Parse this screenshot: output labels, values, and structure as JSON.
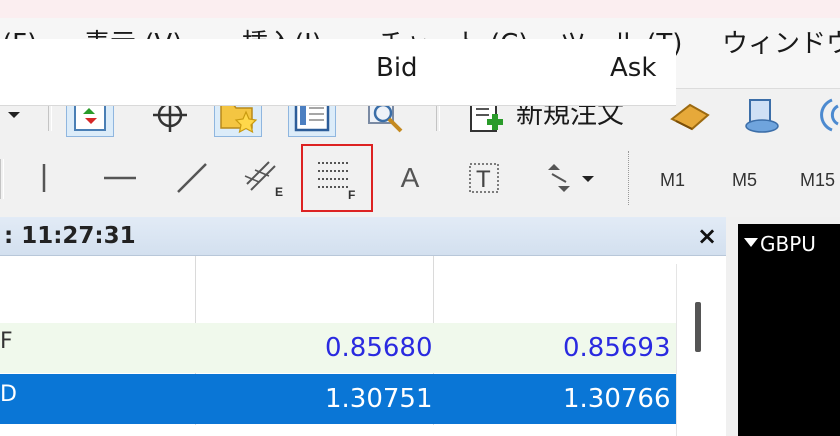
{
  "menu": {
    "items": [
      {
        "label": "(F)",
        "x_hint": "file"
      },
      {
        "label": "表示 (V)"
      },
      {
        "label": "挿入(I)"
      },
      {
        "label": "チャート (C)"
      },
      {
        "label": "ツール (T)"
      },
      {
        "label": "ウィンドウ"
      }
    ]
  },
  "toolbar": {
    "new_order_label": "新規注文"
  },
  "timeframes": [
    "M1",
    "M5",
    "M15"
  ],
  "text_tool_label": "A",
  "market_watch": {
    "time": ": 11:27:31",
    "close_glyph": "×",
    "columns": {
      "bid": "Bid",
      "ask": "Ask"
    },
    "rows": [
      {
        "symbol": "F",
        "bid": "0.85680",
        "ask": "0.85693"
      },
      {
        "symbol": "D",
        "bid": "1.30751",
        "ask": "1.30766"
      }
    ]
  },
  "chart": {
    "symbol": "GBPU"
  },
  "colors": {
    "bid_color_row1": "#2a2ae0",
    "selected_row": "#0a76d6",
    "highlight": "#d22222"
  }
}
